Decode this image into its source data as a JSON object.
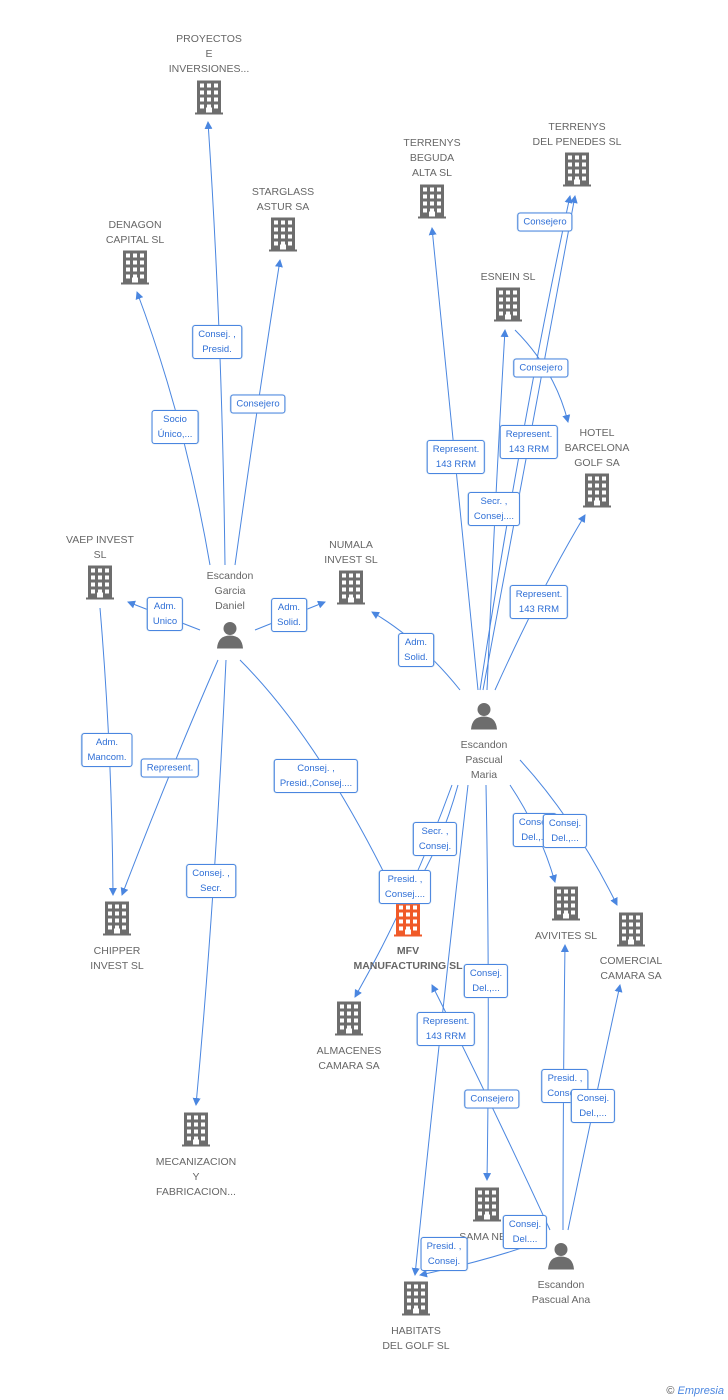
{
  "nodes": {
    "proyectos": [
      "PROYECTOS",
      "E",
      "INVERSIONES..."
    ],
    "starglass": [
      "STARGLASS",
      "ASTUR SA"
    ],
    "denagon": [
      "DENAGON",
      "CAPITAL  SL"
    ],
    "beguda": [
      "TERRENYS",
      "BEGUDA",
      "ALTA SL"
    ],
    "penedes": [
      "TERRENYS",
      "DEL PENEDES SL"
    ],
    "esnein": [
      "ESNEIN SL"
    ],
    "hotel": [
      "HOTEL",
      "BARCELONA",
      "GOLF SA"
    ],
    "vaep": [
      "VAEP INVEST",
      "SL"
    ],
    "numala": [
      "NUMALA",
      "INVEST SL"
    ],
    "daniel": [
      "Escandon",
      "Garcia",
      "Daniel"
    ],
    "maria": [
      "Escandon",
      "Pascual",
      "Maria"
    ],
    "chipper": [
      "CHIPPER",
      "INVEST  SL"
    ],
    "mfv": [
      "MFV",
      "MANUFACTURING SL"
    ],
    "avivites": [
      "AVIVITES SL"
    ],
    "comercial": [
      "COMERCIAL",
      "CAMARA SA"
    ],
    "almacenes": [
      "ALMACENES",
      "CAMARA SA"
    ],
    "mecanizacion": [
      "MECANIZACION",
      "Y",
      "FABRICACION..."
    ],
    "sama": [
      "SAMA NE..."
    ],
    "ana": [
      "Escandon",
      "Pascual Ana"
    ],
    "habitats": [
      "HABITATS",
      "DEL GOLF SL"
    ]
  },
  "edge_labels": [
    [
      "Consej. ,",
      "Presid."
    ],
    [
      "Consejero"
    ],
    [
      "Socio",
      "Único,..."
    ],
    [
      "Adm.",
      "Unico"
    ],
    [
      "Adm.",
      "Solid."
    ],
    [
      "Adm.",
      "Solid."
    ],
    [
      "Adm.",
      "Mancom."
    ],
    [
      "Represent."
    ],
    [
      "Consej. ,",
      "Presid.,Consej...."
    ],
    [
      "Consej. ,",
      "Secr."
    ],
    [
      "Consejero"
    ],
    [
      "Consejero"
    ],
    [
      "Represent.",
      "143 RRM"
    ],
    [
      "Represent.",
      "143 RRM"
    ],
    [
      "Secr. ,",
      "Consej...."
    ],
    [
      "Represent.",
      "143 RRM"
    ],
    [
      "Secr. ,",
      "Consej."
    ],
    [
      "Presid. ,",
      "Consej...."
    ],
    [
      "Consej.",
      "Del.,..."
    ],
    [
      "Consej.",
      "Del.,..."
    ],
    [
      "Consej.",
      "Del.,..."
    ],
    [
      "Represent.",
      "143 RRM"
    ],
    [
      "Consejero"
    ],
    [
      "Presid. ,",
      "Conse..."
    ],
    [
      "Consej.",
      "Del.,..."
    ],
    [
      "Consej.",
      "Del...."
    ],
    [
      "Presid. ,",
      "Consej."
    ]
  ],
  "colors": {
    "edge": "#4a86e0",
    "company": "#6d6d6d",
    "highlight": "#f05a28"
  },
  "footer": {
    "copyright": "©",
    "brand": "Empresia"
  }
}
